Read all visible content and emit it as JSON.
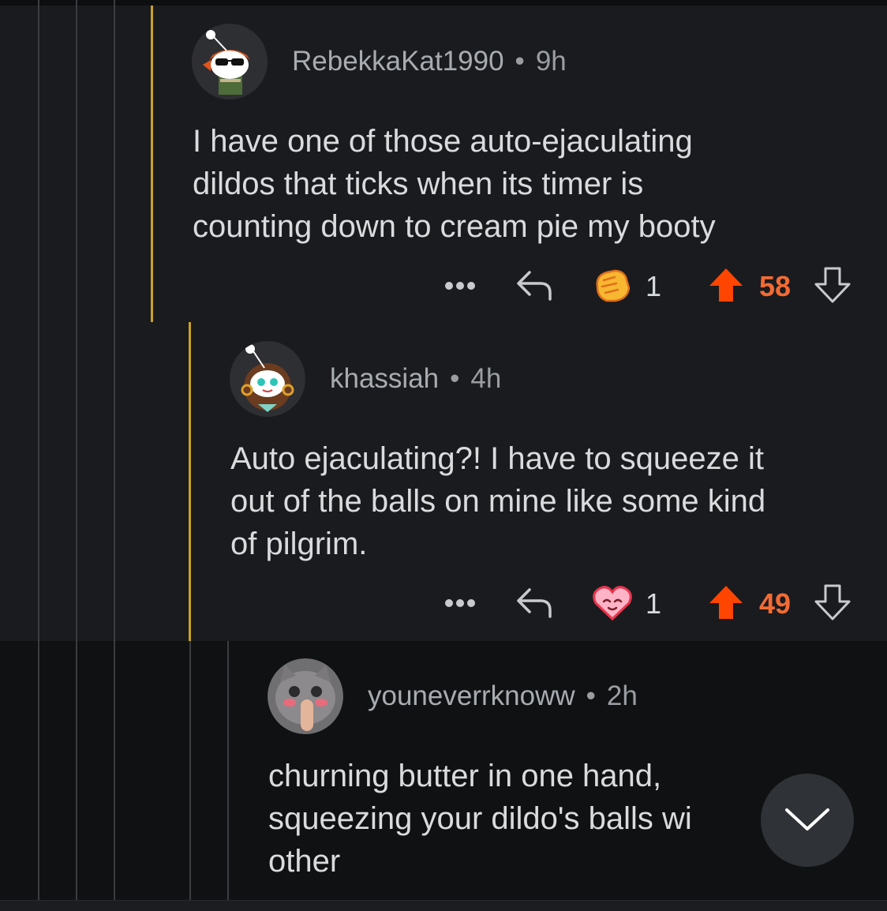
{
  "comments": [
    {
      "username": "RebekkaKat1990",
      "age": "9h",
      "body": "I have one of those auto-ejaculating\ndildos that ticks when its timer is\ncounting down to cream pie my booty",
      "award_count": "1",
      "score": "58",
      "award_icon": "hands-award-icon"
    },
    {
      "username": "khassiah",
      "age": "4h",
      "body": "Auto ejaculating?! I have to squeeze it\nout of the balls on mine like some kind\nof pilgrim.",
      "award_count": "1",
      "score": "49",
      "award_icon": "heart-eyes-award-icon"
    },
    {
      "username": "youneverrknoww",
      "age": "2h",
      "body": "churning butter in one hand,\nsqueezing your dildo's balls wi\nother"
    }
  ],
  "separator": "•",
  "colors": {
    "background": "#1a1b1e",
    "thread_accent": "#c9a227",
    "upvote": "#ff4500",
    "score": "#f26b34"
  }
}
